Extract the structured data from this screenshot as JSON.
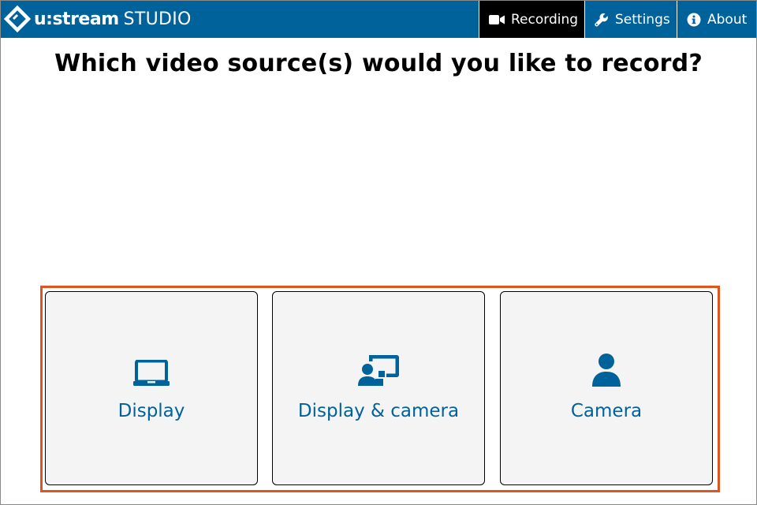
{
  "app": {
    "brand": "u:stream",
    "product": "STUDIO"
  },
  "nav": {
    "items": [
      {
        "label": "Recording",
        "icon": "video-camera-icon",
        "active": true
      },
      {
        "label": "Settings",
        "icon": "wrench-icon",
        "active": false
      },
      {
        "label": "About",
        "icon": "info-icon",
        "active": false
      }
    ]
  },
  "main": {
    "heading": "Which video source(s) would you like to record?",
    "sources": [
      {
        "label": "Display",
        "icon": "laptop-icon"
      },
      {
        "label": "Display & camera",
        "icon": "presenter-screen-icon"
      },
      {
        "label": "Camera",
        "icon": "user-icon"
      }
    ]
  },
  "colors": {
    "topbar": "#00629b",
    "active_tab": "#000000",
    "accent": "#00629b",
    "highlight_border": "#e0541d",
    "card_background": "#f4f4f4"
  }
}
